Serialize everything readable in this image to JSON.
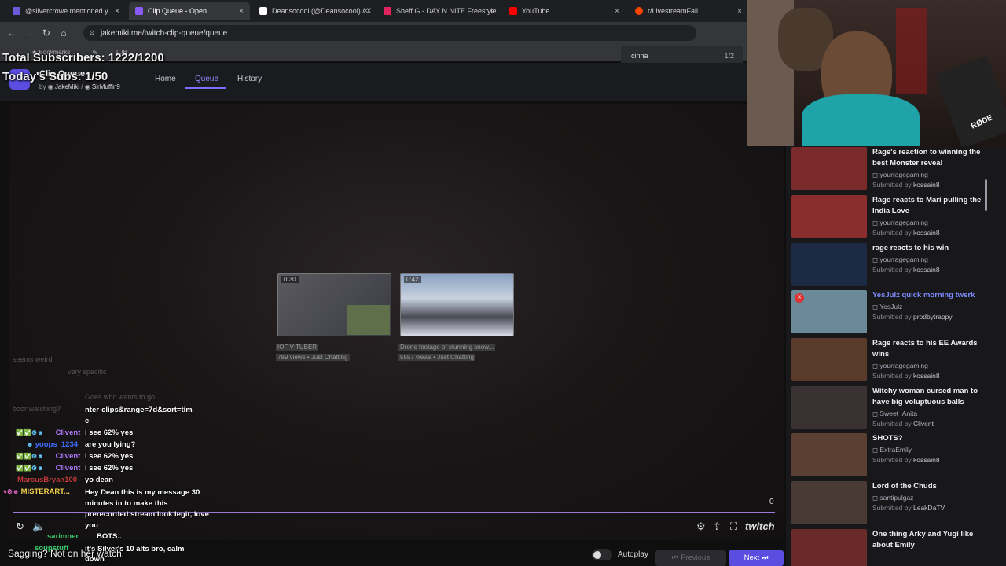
{
  "browser": {
    "tabs": [
      {
        "label": "@siivercrowe mentioned y",
        "color": "#6b5bd6"
      },
      {
        "label": "Clip Queue - Open",
        "color": "#8a5cf6",
        "active": true
      },
      {
        "label": "Deansocool (@Deansocool) / X",
        "color": "#ffffff"
      },
      {
        "label": "Sheff G - DAY N NITE Freestyle",
        "color": "#e0245e"
      },
      {
        "label": "YouTube",
        "color": "#ff0000"
      },
      {
        "label": "r/LivestreamFail",
        "color": "#ff4500"
      }
    ],
    "close_glyph": "×",
    "url": "jakemiki.me/twitch-clip-queue/queue",
    "bookmarks_label": "Bookmarks",
    "bookmark_items": [
      "w",
      "LJB"
    ]
  },
  "findbar": {
    "query": "cinna",
    "count": "1/2"
  },
  "site": {
    "app_title": "Clip Queue",
    "by_label": "by",
    "authors": [
      "JakeMiki",
      "SirMuffin9"
    ],
    "nav": [
      "Home",
      "Queue",
      "History"
    ],
    "active_nav": "Queue"
  },
  "overlay": {
    "total_subs": "Total Subscribers: 1222/1200",
    "today_subs": "Today's Subs: 1/50",
    "caption": "Sagging? Not on her watch."
  },
  "player": {
    "thumbs": [
      {
        "duration": "0:30",
        "title": "IOF V TUBER",
        "meta": "789 views • Just Chatting"
      },
      {
        "duration": "0:42",
        "title": "Drone footage of stunning snow...",
        "meta": "5557 views • Just Chatting"
      }
    ],
    "counter": "0",
    "brand": "twitch"
  },
  "chat": {
    "faint_lines": [
      "seems weird",
      "very specific",
      "Goes who wants to go",
      "boor watching?",
      "nter-clips&range=7d&sort=tim",
      "e"
    ],
    "lines": [
      {
        "user": "Clivent",
        "color": "#b07cff",
        "msg": "i see 62% yes"
      },
      {
        "user": "yoops_1234",
        "color": "#3d6cff",
        "msg": "are you lying?"
      },
      {
        "user": "Clivent",
        "color": "#b07cff",
        "msg": "i see 62% yes"
      },
      {
        "user": "Clivent",
        "color": "#b07cff",
        "msg": "i see 62% yes"
      },
      {
        "user": "MarcusBryan100",
        "color": "#c23a3a",
        "msg": "yo dean"
      },
      {
        "user": "MISTERART...",
        "color": "#f3d04a",
        "msg": "Hey Dean this is my message 30 minutes in to make this prerecorded stream look legit, love you"
      },
      {
        "user": "sarimner",
        "color": "#3cc86a",
        "msg": "BOTS.."
      },
      {
        "user": "soupstuff",
        "color": "#3cc86a",
        "msg": "it's Silver's 10 alts bro, calm down"
      }
    ]
  },
  "queue": [
    {
      "title": "Rage's reaction to winning the best Monster reveal",
      "channel": "yourragegaming",
      "submitted_by": "kossain8",
      "thumb": "#7a2a2a"
    },
    {
      "title": "Rage reacts to Mari pulling the India Love",
      "channel": "yourragegaming",
      "submitted_by": "kossain8",
      "thumb": "#8a2d2d"
    },
    {
      "title": "rage reacts to his win",
      "channel": "yourragegaming",
      "submitted_by": "kossain8",
      "thumb": "#1c2a44"
    },
    {
      "title": "YesJulz quick morning twerk",
      "channel": "YesJulz",
      "submitted_by": "prodbytrappy",
      "thumb": "#6a8a9a",
      "highlight": true
    },
    {
      "title": "Rage reacts to his EE Awards wins",
      "channel": "yourragegaming",
      "submitted_by": "kossain8",
      "thumb": "#5a3a2a"
    },
    {
      "title": "Witchy woman cursed man to have big voluptuous balls",
      "channel": "Sweet_Anita",
      "submitted_by": "Clivent",
      "thumb": "#3a3232"
    },
    {
      "title": "SHOTS?",
      "channel": "ExtraEmily",
      "submitted_by": "kossain8",
      "thumb": "#5a4032"
    },
    {
      "title": "Lord of the Chuds",
      "channel": "santipulgaz",
      "submitted_by": "LeakDaTV",
      "thumb": "#4a3a36"
    },
    {
      "title": "One thing Arky and Yugi like about Emily",
      "channel": "",
      "submitted_by": "",
      "thumb": "#6a2a2a"
    }
  ],
  "submitted_by_label": "Submitted by",
  "footer": {
    "autoplay": "Autoplay",
    "previous": "Previous",
    "next": "Next"
  },
  "webcam_brand": "RØDE"
}
